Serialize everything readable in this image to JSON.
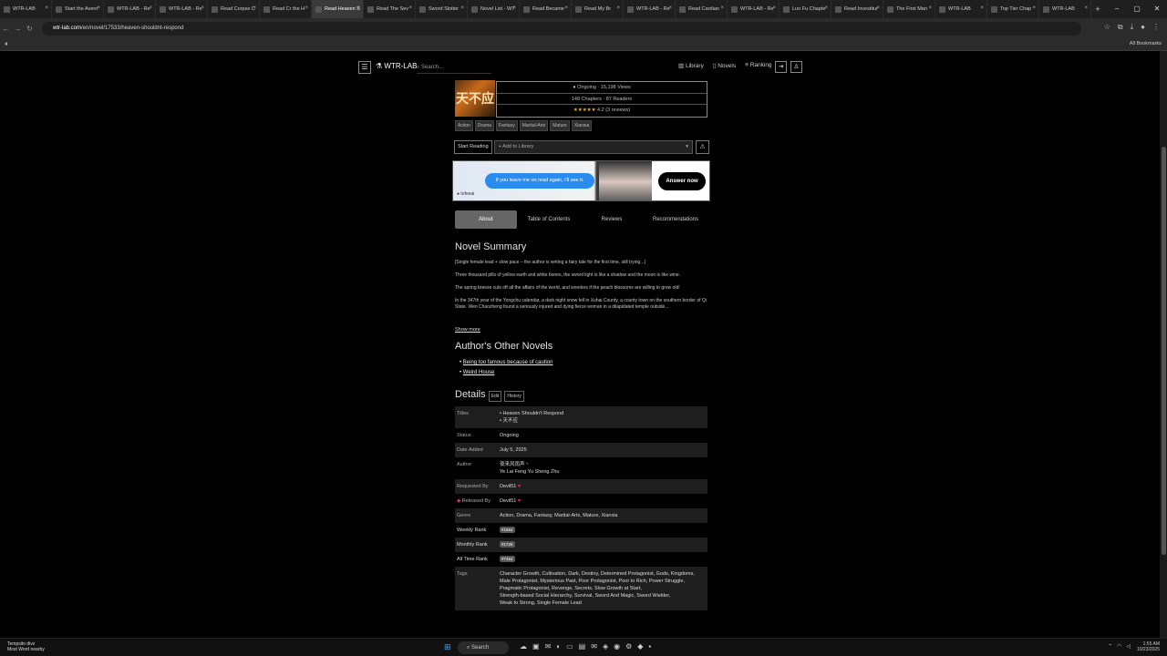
{
  "browser": {
    "tabs": [
      "WTR-LAB",
      "Start the Avent",
      "WTR-LAB - Re",
      "WTR-LAB - Re",
      "Read Corpse C",
      "Read Cr the H",
      "Read Heaven S",
      "Read The Sev",
      "Sword Slotter",
      "Novel List - WT",
      "Read Became",
      "Read My Br",
      "WTR-LAB - Re",
      "Read Cardian",
      "WTR-LAB - Re",
      "Luo Fu Chapte",
      "Read Investitur",
      "The First Man",
      "WTR-LAB",
      "Top Tier Chap",
      "WTR-LAB"
    ],
    "active_tab": 6,
    "new_tab": "+",
    "url_host": "wtr-lab.com",
    "url_path": "/en/novel/17533/heaven-shouldnt-respond",
    "bookmarks_label": "All Bookmarks",
    "win_min": "–",
    "win_max": "▢",
    "win_close": "✕"
  },
  "site": {
    "logo": "WTR-LAB",
    "search_placeholder": "Search...",
    "nav": [
      "Library",
      "Novels",
      "Ranking"
    ]
  },
  "novel": {
    "cover_text": "天不应",
    "status_line": "● Ongoing · 15,198 Views",
    "chapters_line": "148 Chapters · 87 Readers",
    "rating_stars": "★★★★★",
    "rating_text": "4.2 (3 reviews)",
    "genre_chips": [
      "Action",
      "Drama",
      "Fantasy",
      "Martial-Arts",
      "Mature",
      "Xianxia"
    ],
    "start_reading": "Start Reading",
    "add_library": "+ Add to Library",
    "warn_icon": "⚠"
  },
  "ad": {
    "bubble": "If you leave me on read again, I'll see it.",
    "answer": "Answer now",
    "brand": "● tofeeai"
  },
  "content_tabs": [
    "About",
    "Table of Contents",
    "Reviews",
    "Recommendations"
  ],
  "summary": {
    "title": "Novel Summary",
    "paragraphs": [
      "[Single female lead + slow pace – the author is writing a fairy tale for the first time, still trying...]",
      "Three thousand pills of yellow earth and white bones, the sword light is like a shadow and the moon is like wine.",
      "The spring breeze cuts off all the affairs of the world, and wonders if the peach blossoms are willing to grow old!",
      "In the 347th year of the Yongchu calendar, a dark night snow fell in Xuhai County, a county town on the southern border of Qi State. Wen Chaozheng found a seriously injured and dying fierce woman in a dilapidated temple outside..."
    ],
    "show_more": "Show more"
  },
  "other_novels": {
    "title": "Author's Other Novels",
    "items": [
      "Being too famous because of caution",
      "Weird House"
    ]
  },
  "details": {
    "title": "Details",
    "edit": "Edit",
    "history": "History",
    "titles_label": "Titles",
    "titles": [
      "Heaven Shouldn't Respond",
      "天不应"
    ],
    "status_label": "Status",
    "status": "Ongoing",
    "date_label": "Date Added",
    "date": "July 5, 2025",
    "author_label": "Author",
    "author_cn": "夜来风雨声丶",
    "author_en": "Ye Lai Feng Yu Sheng Zhu",
    "requested_label": "Requested By",
    "requested": "Devil51",
    "released_label": "Released By",
    "released": "Devil51",
    "genre_label": "Genre",
    "genre": "Action, Drama, Fantasy, Martial-Arts, Mature, Xianxia",
    "weekly_label": "Weekly Rank",
    "weekly": "#1664",
    "monthly_label": "Monthly Rank",
    "monthly": "#1726",
    "alltime_label": "All Time Rank",
    "alltime": "#7454",
    "tags_label": "Tags",
    "tags_lines": [
      "Character Growth, Cultivation, Dark, Destiny, Determined Protagonist, Gods, Kingdoms,",
      "Male Protagonist, Mysterious Past, Poor Protagonist, Poor to Rich, Power Struggle,",
      "Pragmatic Protagonist, Revenge, Secrets, Slow Growth at Start,",
      "Strength-based Social Hierarchy, Survival, Sword And Magic, Sword Wielder,",
      "Weak to Strong, Single Female Lead"
    ]
  },
  "taskbar": {
    "weather_temp": "Tempsito divs",
    "weather_desc": "Most Word nearby",
    "search": "Search",
    "time": "1:55 AM",
    "date": "10/23/2025"
  }
}
